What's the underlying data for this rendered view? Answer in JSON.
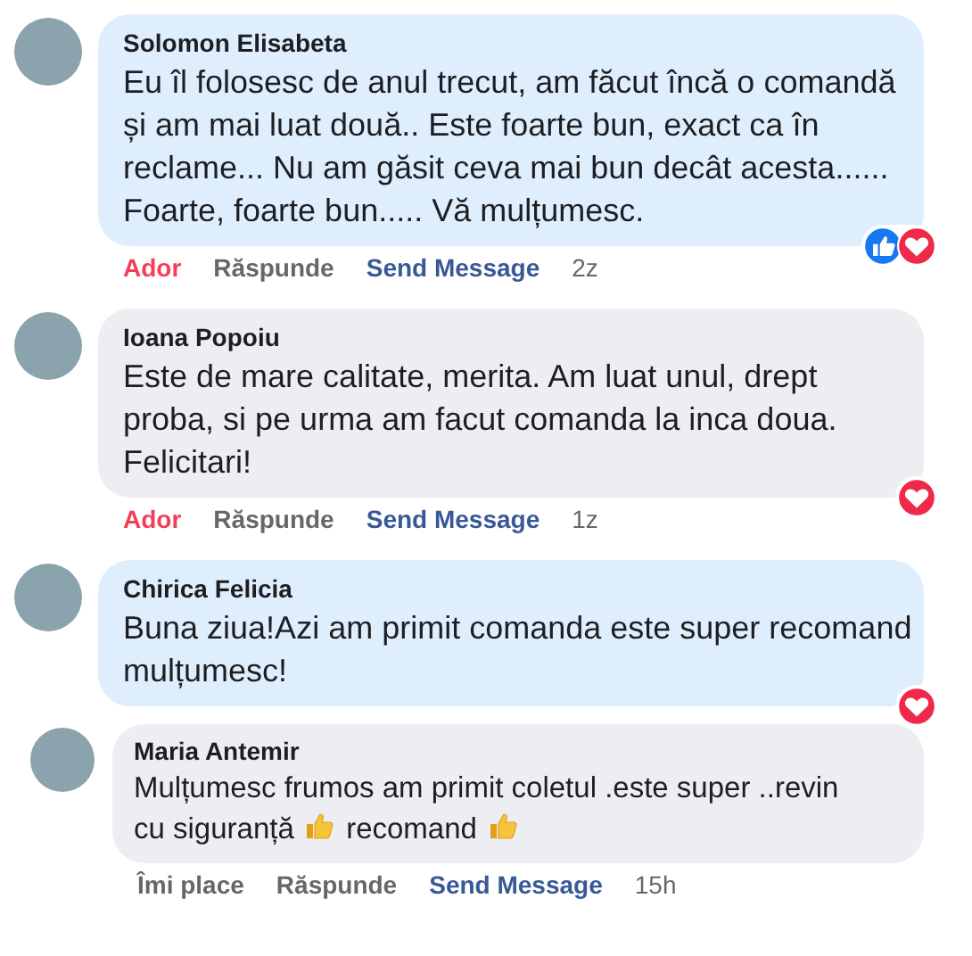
{
  "comments": [
    {
      "author": "Solomon Elisabeta",
      "highlighted": true,
      "body": [
        {
          "kind": "text",
          "text": "Eu îl folosesc de anul trecut, am făcut încă o comandă și am mai luat două.. Este foarte bun, exact ca în reclame... Nu am găsit ceva mai bun decât acesta...... Foarte, foarte bun..... Vă mulțumesc."
        }
      ],
      "reactions": [
        {
          "kind": "like"
        },
        {
          "kind": "love"
        }
      ],
      "actions": {
        "react": "Ador",
        "reacted": true,
        "reply": "Răspunde",
        "message": "Send Message",
        "time": "2z"
      }
    },
    {
      "author": "Ioana Popoiu",
      "highlighted": false,
      "body": [
        {
          "kind": "text",
          "text": "Este de mare calitate, merita. Am luat unul, drept proba, si pe urma am facut comanda la inca doua. Felicitari!"
        }
      ],
      "reactions": [
        {
          "kind": "love"
        }
      ],
      "actions": {
        "react": "Ador",
        "reacted": true,
        "reply": "Răspunde",
        "message": "Send Message",
        "time": "1z"
      }
    },
    {
      "author": "Chirica Felicia",
      "highlighted": true,
      "body": [
        {
          "kind": "text",
          "text": "Buna ziua!Azi am primit comanda este super recomand mulțumesc!"
        }
      ],
      "reactions": [
        {
          "kind": "love"
        }
      ]
    },
    {
      "author": "Maria Antemir",
      "highlighted": false,
      "body": [
        {
          "kind": "text",
          "text": "Mulțumesc frumos am primit coletul .este super ..revin"
        },
        {
          "kind": "text",
          "text": "cu siguranță"
        },
        {
          "kind": "thumbs-up"
        },
        {
          "kind": "text",
          "text": "recomand"
        },
        {
          "kind": "thumbs-up"
        }
      ],
      "actions": {
        "react": "Îmi place",
        "reacted": false,
        "reply": "Răspunde",
        "message": "Send Message",
        "time": "15h"
      }
    }
  ]
}
